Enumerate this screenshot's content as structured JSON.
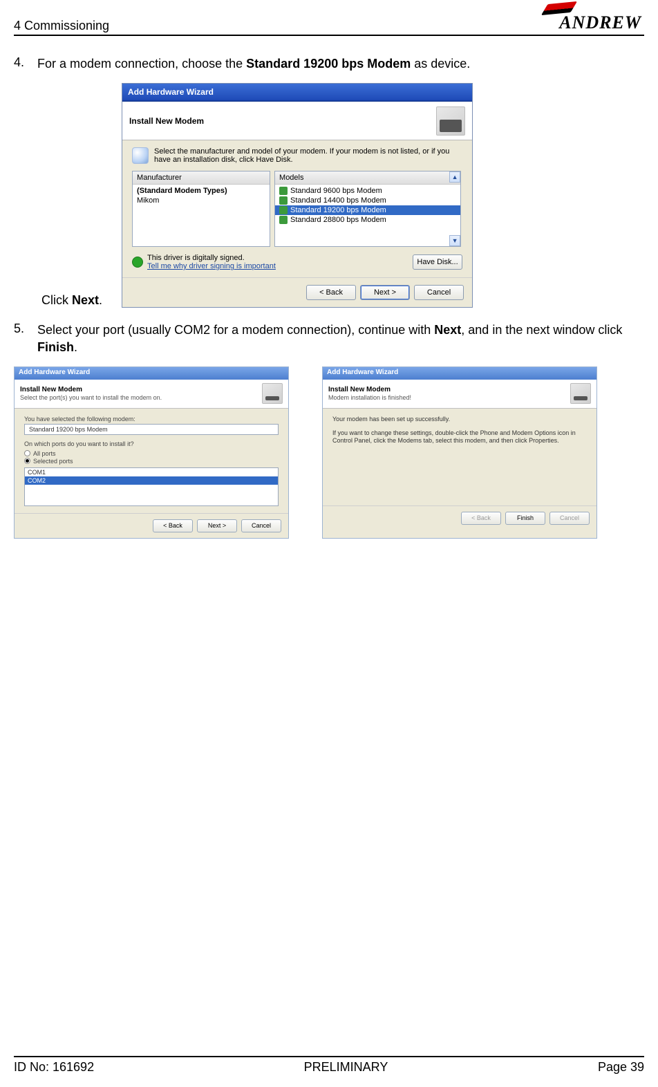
{
  "header": {
    "section": "4 Commissioning",
    "brand": "ANDREW"
  },
  "steps": {
    "s4": {
      "num": "4.",
      "text_a": "For a modem connection, choose the ",
      "text_bold": "Standard 19200 bps Modem",
      "text_b": " as device.",
      "caption_a": "Click ",
      "caption_bold": "Next",
      "caption_b": "."
    },
    "s5": {
      "num": "5.",
      "text_a": "Select your port (usually COM2 for a modem connection), continue with ",
      "text_bold1": "Next",
      "text_mid": ", and in the next window click ",
      "text_bold2": "Finish",
      "text_end": "."
    }
  },
  "wizard1": {
    "title": "Add Hardware Wizard",
    "banner": "Install New Modem",
    "instruction": "Select the manufacturer and model of your modem. If your modem is not listed, or if you have an installation disk, click Have Disk.",
    "mfg_header": "Manufacturer",
    "mfg_items": [
      "(Standard Modem Types)",
      "Mikom"
    ],
    "mdl_header": "Models",
    "mdl_items": [
      "Standard  9600 bps Modem",
      "Standard 14400 bps Modem",
      "Standard 19200 bps Modem",
      "Standard 28800 bps Modem"
    ],
    "mdl_selected_index": 2,
    "driver_signed": "This driver is digitally signed.",
    "driver_link": "Tell me why driver signing is important",
    "btn_havedisk": "Have Disk...",
    "btn_back": "< Back",
    "btn_next": "Next >",
    "btn_cancel": "Cancel"
  },
  "wizard2": {
    "title": "Add Hardware Wizard",
    "banner": "Install New Modem",
    "banner_sub": "Select the port(s) you want to install the modem on.",
    "selected_label": "You have selected the following modem:",
    "selected_value": "Standard 19200 bps Modem",
    "question": "On which ports do you want to install it?",
    "radio_all": "All ports",
    "radio_sel": "Selected ports",
    "ports": [
      "COM1",
      "COM2"
    ],
    "port_selected_index": 1,
    "btn_back": "< Back",
    "btn_next": "Next >",
    "btn_cancel": "Cancel"
  },
  "wizard3": {
    "title": "Add Hardware Wizard",
    "banner": "Install New Modem",
    "banner_sub": "Modem installation is finished!",
    "line1": "Your modem has been set up successfully.",
    "line2": "If you want to change these settings, double-click the Phone and Modem Options icon in Control Panel, click the Modems tab, select this modem, and then click Properties.",
    "btn_back": "< Back",
    "btn_finish": "Finish",
    "btn_cancel": "Cancel"
  },
  "footer": {
    "left": "ID No: 161692",
    "center": "PRELIMINARY",
    "right": "Page 39"
  }
}
